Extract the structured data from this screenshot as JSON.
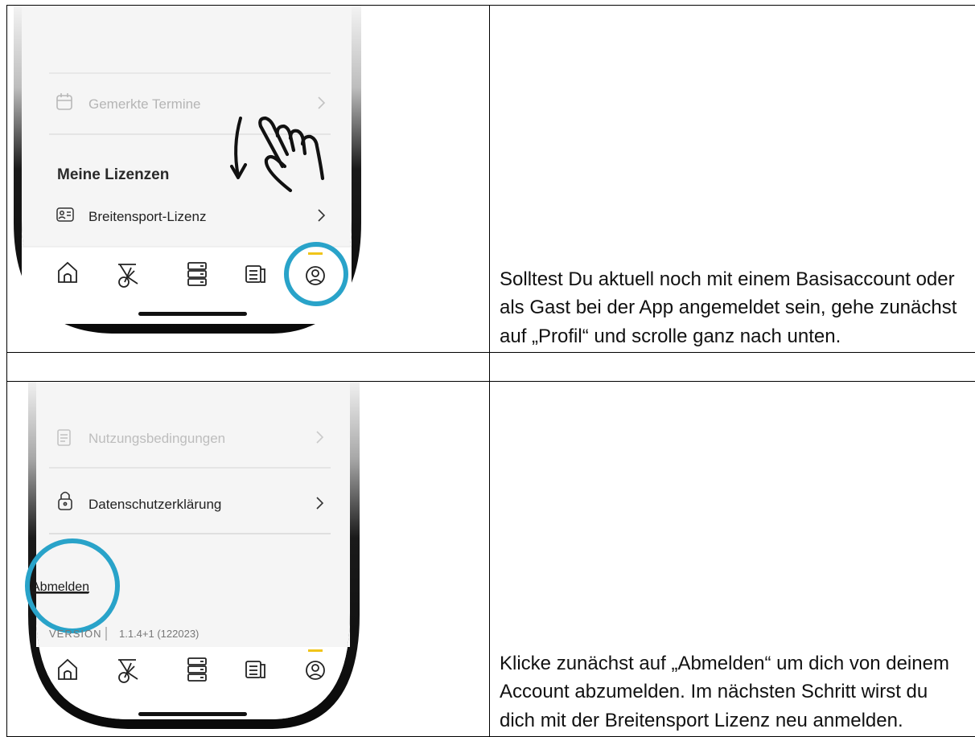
{
  "step1": {
    "screen": {
      "faded_item": "Gemerkte Termine",
      "section_title": "Meine Lizenzen",
      "license_item": "Breitensport-Lizenz"
    },
    "nav": {
      "items": [
        "home-icon",
        "bike-icon",
        "stack-icon",
        "news-icon",
        "profile-icon"
      ],
      "active": "profile-icon",
      "accent": "#f0c419"
    },
    "highlight_color": "#29a3c9",
    "instruction": "Solltest Du aktuell noch mit einem Basisaccount oder als Gast bei der App angemeldet sein, gehe zunächst auf „Profil“ und scrolle ganz nach unten."
  },
  "step2": {
    "screen": {
      "faded_item": "Nutzungsbedingungen",
      "privacy_item": "Datenschutzerklärung",
      "logout_link": "Abmelden",
      "version_label": "VERSION",
      "version_value": "1.1.4+1 (122023)"
    },
    "nav": {
      "items": [
        "home-icon",
        "bike-icon",
        "stack-icon",
        "news-icon",
        "profile-icon"
      ],
      "active": "profile-icon",
      "accent": "#f0c419"
    },
    "highlight_color": "#29a3c9",
    "instruction": "Klicke zunächst auf „Abmelden“ um dich von deinem Account abzumelden. Im nächsten Schritt wirst du dich mit der Breitensport Lizenz neu anmelden."
  }
}
